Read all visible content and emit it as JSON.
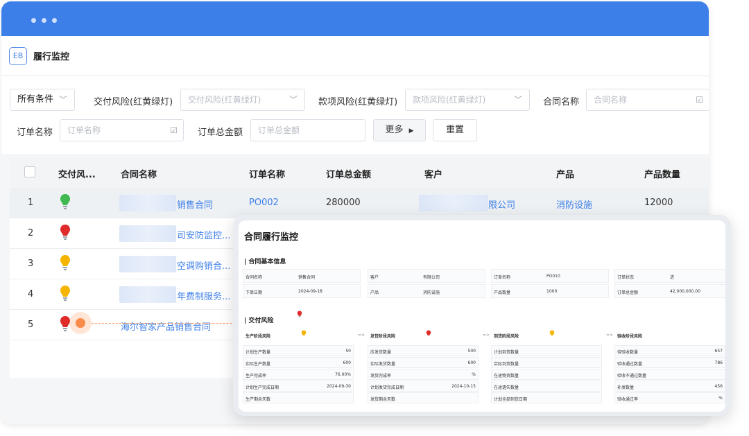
{
  "window": {
    "dots": [
      "dot",
      "dot",
      "dot"
    ]
  },
  "app": {
    "logo": "EB",
    "title": "履行监控"
  },
  "filters": {
    "all_conditions": "所有条件",
    "delivery_risk_label": "交付风险(红黄绿灯)",
    "delivery_risk_placeholder": "交付风险(红黄绿灯)",
    "payment_risk_label": "款项风险(红黄绿灯)",
    "payment_risk_placeholder": "款项风险(红黄绿灯)",
    "contract_name_label": "合同名称",
    "contract_name_placeholder": "合同名称",
    "order_name_label": "订单名称",
    "order_name_placeholder": "订单名称",
    "order_total_label": "订单总金额",
    "order_total_placeholder": "订单总金额",
    "more_label": "更多",
    "reset_label": "重置"
  },
  "table": {
    "headers": [
      "交付风...",
      "合同名称",
      "订单名称",
      "订单总金额",
      "客户",
      "产品",
      "产品数量"
    ],
    "rows": [
      {
        "no": "1",
        "light": "#3fb950",
        "contract": "销售合同",
        "order": "PO002",
        "amount": "280000",
        "customer": "限公司",
        "product": "消防设施",
        "qty": "12000"
      },
      {
        "no": "2",
        "light": "#e02b2b",
        "contract": "司安防监控..."
      },
      {
        "no": "3",
        "light": "#f5b400",
        "contract": "空调购销合..."
      },
      {
        "no": "4",
        "light": "#f5b400",
        "contract": "年费制服务..."
      },
      {
        "no": "5",
        "light": "#e02b2b",
        "contract": "海尔智家产品销售合同"
      }
    ]
  },
  "panel": {
    "title": "合同履行监控",
    "basic_section": "合同基本信息",
    "basic": [
      {
        "k": "合同名称",
        "v": "销售合同"
      },
      {
        "k": "客户",
        "v": "有限公司"
      },
      {
        "k": "订单名称",
        "v": "PO010"
      },
      {
        "k": "订单状态",
        "v": "进"
      },
      {
        "k": "下单日期",
        "v": "2024-09-18"
      },
      {
        "k": "产品",
        "v": "消防设施"
      },
      {
        "k": "产品数量",
        "v": "1000"
      },
      {
        "k": "订单总金额",
        "v": "42,000,000.00"
      }
    ],
    "risk_section": "交付风险",
    "stages": [
      {
        "name": "生产阶段风险",
        "light": "#f5b400",
        "items": [
          [
            "计划生产数量",
            "50"
          ],
          [
            "实际生产数量",
            "600"
          ],
          [
            "生产完成率",
            "76.00%"
          ],
          [
            "计划生产完成日期",
            "2024-09-30"
          ],
          [
            "生产剩余天数",
            ""
          ]
        ]
      },
      {
        "name": "发货阶段风险",
        "light": "#e02b2b",
        "items": [
          [
            "应发货数量",
            "500"
          ],
          [
            "实际发货数量",
            "600"
          ],
          [
            "发货完成率",
            "%"
          ],
          [
            "计划发货完成日期",
            "2024-10-15"
          ],
          [
            "发货剩余天数",
            ""
          ]
        ]
      },
      {
        "name": "到货阶段风险",
        "light": "#f5b400",
        "items": [
          [
            "计划到货数量",
            ""
          ],
          [
            "实际到货数量",
            ""
          ],
          [
            "在途物资数量",
            ""
          ],
          [
            "在途遗失数量",
            ""
          ],
          [
            "计划全部到货日期",
            ""
          ]
        ]
      },
      {
        "name": "验收阶段风险",
        "light": "",
        "items": [
          [
            "待验收数量",
            "657"
          ],
          [
            "验收通过数量",
            "786"
          ],
          [
            "验收不通过数量",
            ""
          ],
          [
            "补发数量",
            "456"
          ],
          [
            "验收通过率",
            "%"
          ]
        ]
      }
    ],
    "arrow": "=>"
  }
}
